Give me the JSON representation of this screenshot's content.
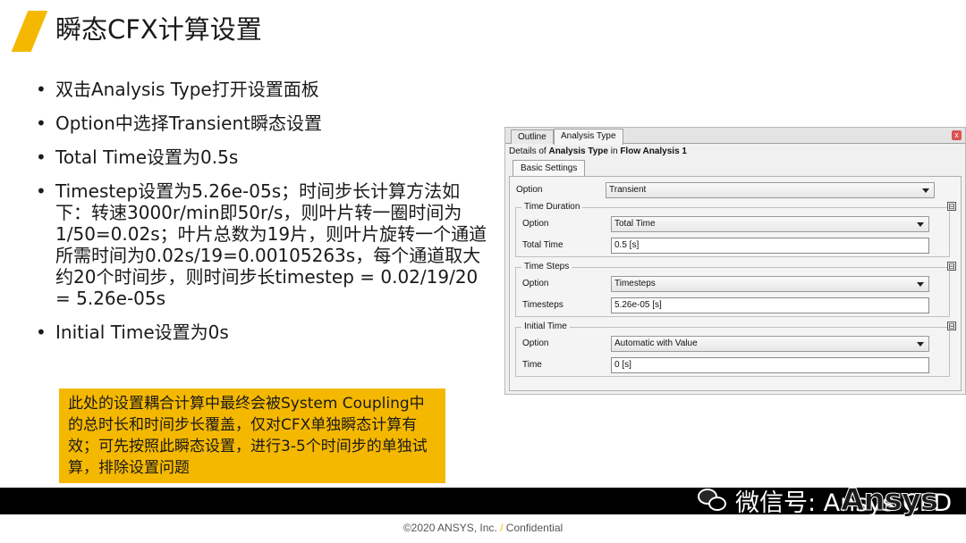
{
  "slide": {
    "title": "瞬态CFX计算设置",
    "bullets": [
      "双击Analysis Type打开设置面板",
      "Option中选择Transient瞬态设置",
      "Total Time设置为0.5s",
      "Timestep设置为5.26e-05s；时间步长计算方法如下：转速3000r/min即50r/s，则叶片转一圈时间为1/50=0.02s；叶片总数为19片，则叶片旋转一个通道所需时间为0.02s/19=0.00105263s，每个通道取大约20个时间步，则时间步长timestep = 0.02/19/20 = 5.26e-05s",
      "Initial Time设置为0s"
    ],
    "note": "此处的设置耦合计算中最终会被System Coupling中的总时长和时间步长覆盖，仅对CFX单独瞬态计算有效；可先按照此瞬态设置，进行3-5个时间步的单独试算，排除设置问题"
  },
  "panel": {
    "tabs": [
      "Outline",
      "Analysis Type"
    ],
    "details_prefix": "Details of ",
    "details_object": "Analysis Type",
    "details_mid": " in ",
    "details_target": "Flow Analysis 1",
    "subtab": "Basic Settings",
    "option_label": "Option",
    "option_value": "Transient",
    "groups": {
      "duration": {
        "title": "Time Duration",
        "option_label": "Option",
        "option_value": "Total Time",
        "field_label": "Total Time",
        "field_value": "0.5 [s]"
      },
      "steps": {
        "title": "Time Steps",
        "option_label": "Option",
        "option_value": "Timesteps",
        "field_label": "Timesteps",
        "field_value": "5.26e-05 [s]"
      },
      "initial": {
        "title": "Initial Time",
        "option_label": "Option",
        "option_value": "Automatic with Value",
        "field_label": "Time",
        "field_value": "0 [s]"
      }
    },
    "collapse_symbol": "⊟",
    "close_symbol": "x"
  },
  "watermark": {
    "text": "微信号: Ansys CFD"
  },
  "logo": {
    "text": "Ansys"
  },
  "footer": {
    "text": "©2020 ANSYS, Inc.",
    "slash": "/",
    "confidential": "Confidential"
  },
  "colors": {
    "accent": "#f5b800",
    "band": "#000000"
  }
}
